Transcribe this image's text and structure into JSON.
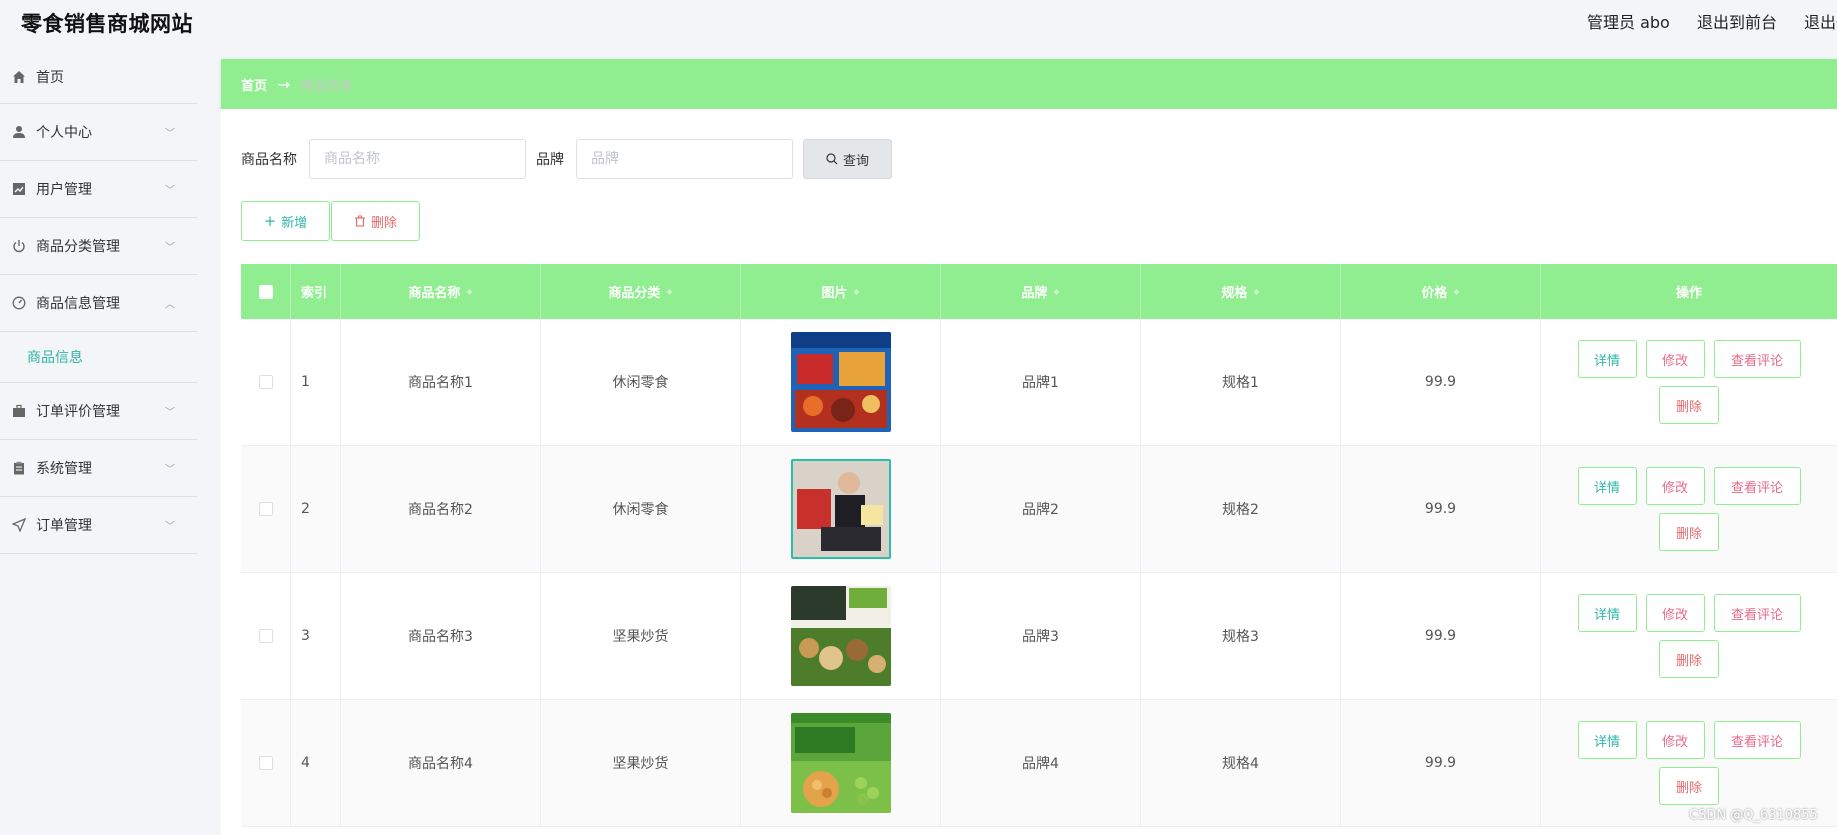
{
  "header": {
    "site_title": "零食销售商城网站",
    "admin_label": "管理员 abo",
    "exit_front": "退出到前台",
    "logout": "退出登录"
  },
  "sidebar": {
    "items": [
      {
        "label": "首页",
        "icon": "home-icon"
      },
      {
        "label": "个人中心",
        "icon": "user-icon"
      },
      {
        "label": "用户管理",
        "icon": "chart-icon"
      },
      {
        "label": "商品分类管理",
        "icon": "power-icon"
      },
      {
        "label": "商品信息管理",
        "icon": "gauge-icon"
      },
      {
        "label": "订单评价管理",
        "icon": "briefcase-icon"
      },
      {
        "label": "系统管理",
        "icon": "clipboard-icon"
      },
      {
        "label": "订单管理",
        "icon": "send-icon"
      }
    ],
    "submenu_item": "商品信息"
  },
  "breadcrumb": {
    "home": "首页",
    "separator": "→",
    "current": "商品信息"
  },
  "search": {
    "name_label": "商品名称",
    "name_placeholder": "商品名称",
    "brand_label": "品牌",
    "brand_placeholder": "品牌",
    "query_button": "查询"
  },
  "actions": {
    "add_button": "新增",
    "delete_button": "删除"
  },
  "table": {
    "headers": {
      "index": "索引",
      "name": "商品名称",
      "category": "商品分类",
      "image": "图片",
      "brand": "品牌",
      "spec": "规格",
      "price": "价格",
      "ops": "操作"
    },
    "rows": [
      {
        "index": "1",
        "name": "商品名称1",
        "category": "休闲零食",
        "brand": "品牌1",
        "spec": "规格1",
        "price": "99.9"
      },
      {
        "index": "2",
        "name": "商品名称2",
        "category": "休闲零食",
        "brand": "品牌2",
        "spec": "规格2",
        "price": "99.9"
      },
      {
        "index": "3",
        "name": "商品名称3",
        "category": "坚果炒货",
        "brand": "品牌3",
        "spec": "规格3",
        "price": "99.9"
      },
      {
        "index": "4",
        "name": "商品名称4",
        "category": "坚果炒货",
        "brand": "品牌4",
        "spec": "规格4",
        "price": "99.9"
      }
    ],
    "op_labels": {
      "detail": "详情",
      "edit": "修改",
      "review": "查看评论",
      "delete": "删除"
    }
  },
  "watermark": "CSDN @Q_6310855",
  "colors": {
    "accent_green": "#90ee90",
    "teal_text": "#2fb6a8",
    "pink_text": "#e96a8a",
    "red_text": "#e96a6a"
  }
}
